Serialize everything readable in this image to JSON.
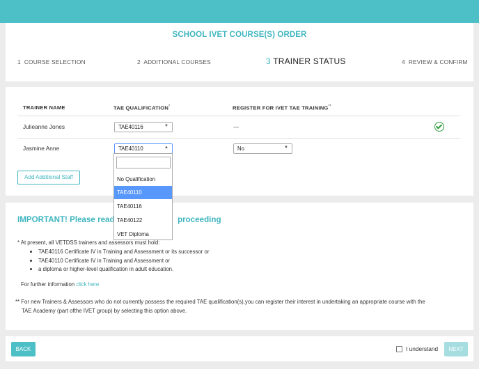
{
  "header": {
    "title": "SCHOOL IVET COURSE(S) ORDER",
    "steps": [
      {
        "num": "1",
        "label": "COURSE SELECTION"
      },
      {
        "num": "2",
        "label": "ADDITIONAL COURSES"
      },
      {
        "num": "3",
        "label": "TRAINER STATUS"
      },
      {
        "num": "4",
        "label": "REVIEW & CONFIRM"
      }
    ]
  },
  "table": {
    "col_trainer": "TRAINER NAME",
    "col_tae": "TAE QUALIFICATION",
    "col_tae_mark": "*",
    "col_register": "REGISTER FOR IVET TAE TRAINING",
    "col_register_mark": "**",
    "rows": [
      {
        "name": "Julieanne Jones",
        "tae": "TAE40116",
        "register": "---"
      },
      {
        "name": "Jasmine Anne",
        "tae": "TAE40110",
        "register": "No"
      }
    ],
    "add_staff": "Add Additional Staff"
  },
  "dropdown": {
    "search_value": "",
    "options": [
      "No Qualification",
      "TAE40110",
      "TAE40116",
      "TAE40122",
      "VET Diploma"
    ],
    "highlighted": "TAE40110"
  },
  "important": {
    "title_start": "IMPORTANT! Please read",
    "title_end": "proceeding",
    "intro": "* At present, all VETDSS trainers and assessors must hold:",
    "bullets": [
      "TAE40116 Certificate IV in Training and Assessment or its successor or",
      "TAE40110 Certificate IV in Training and Assessment or",
      "a diploma or higher-level qualification in adult education."
    ],
    "further_text": "For further information",
    "further_link": "click here",
    "footnote_line1": "** For new Trainers & Assessors who do not currently possess the required TAE qualification(s),you can register their interest in undertaking an appropriate course with the",
    "footnote_line2": "TAE Academy (part ofthe IVET group) by selecting this option above."
  },
  "footer": {
    "back": "BACK",
    "understand": "I understand",
    "next": "NEXT"
  },
  "colors": {
    "accent": "#4dbfc6",
    "accent_text": "#3fb6bf",
    "highlight": "#5897fb",
    "success": "#2e9d3b"
  }
}
